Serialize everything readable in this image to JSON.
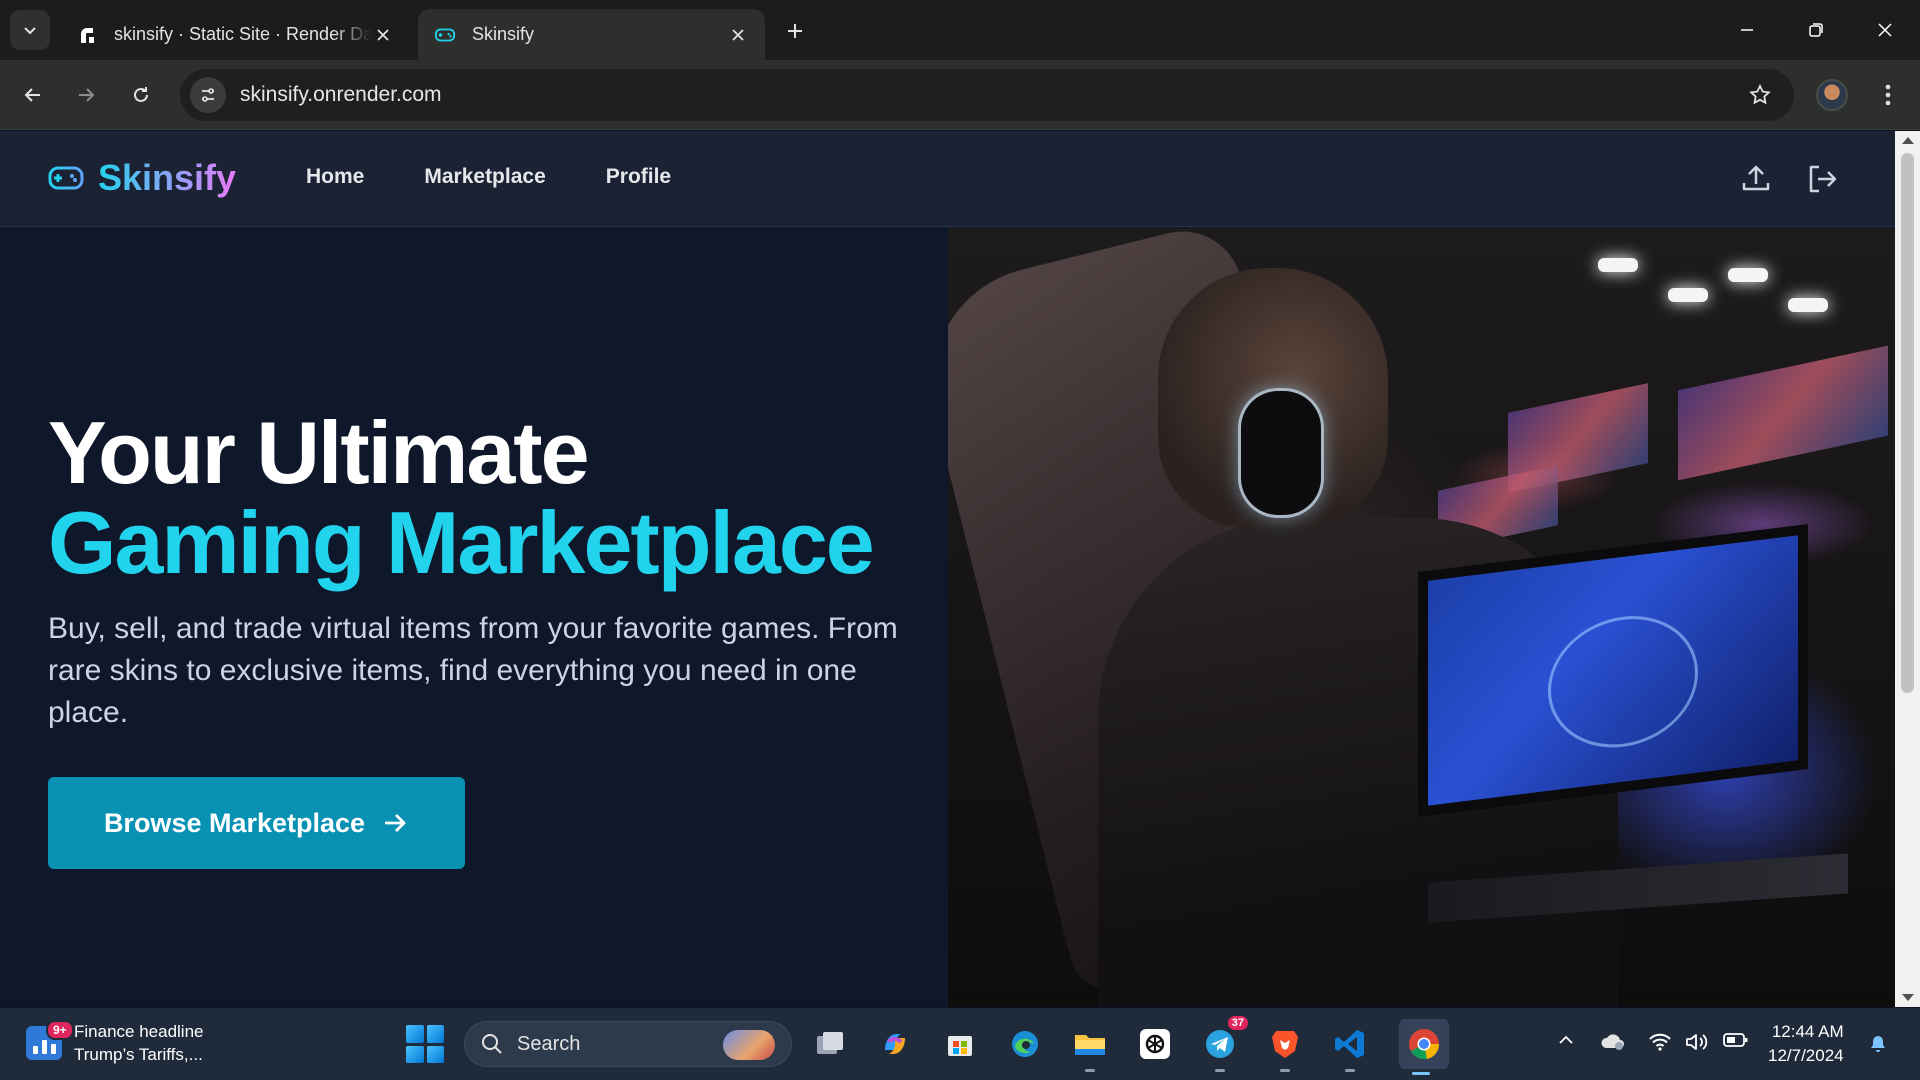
{
  "browser": {
    "tabs": [
      {
        "title": "skinsify · Static Site · Render Dashboard",
        "favicon": "render-icon",
        "active": false
      },
      {
        "title": "Skinsify",
        "favicon": "gamepad-icon",
        "active": true
      }
    ],
    "url": "skinsify.onrender.com"
  },
  "site": {
    "brand": "Skinsify",
    "nav": [
      "Home",
      "Marketplace",
      "Profile"
    ],
    "icons": [
      "upload-icon",
      "logout-icon"
    ],
    "colors": {
      "accent": "#22d3ee",
      "button": "#0891b2",
      "background": "#0f172a",
      "gradient_end": "#e879f9"
    }
  },
  "hero": {
    "title_line1": "Your Ultimate",
    "title_line2": "Gaming Marketplace",
    "description": "Buy, sell, and trade virtual items from your favorite games. From rare skins to exclusive items, find everything you need in one place.",
    "cta": "Browse Marketplace",
    "image": "gamer-wearing-headset-at-esports-arena-photo"
  },
  "taskbar": {
    "news_title": "Finance headline",
    "news_subtitle": "Trump’s Tariffs,...",
    "news_badge": "9+",
    "search_label": "Search",
    "telegram_badge": "37",
    "time": "12:44 AM",
    "date": "12/7/2024"
  }
}
